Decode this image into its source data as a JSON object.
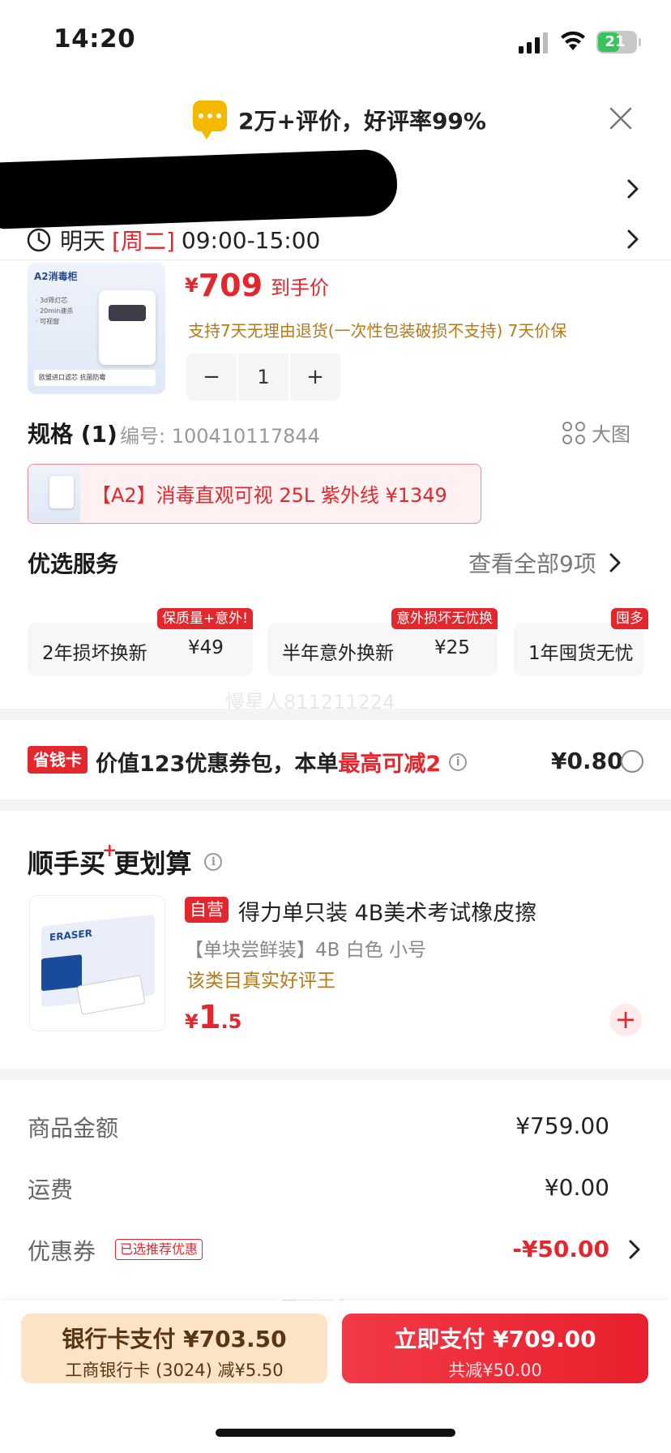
{
  "status_bar": {
    "time": "14:20",
    "battery": "21"
  },
  "banner": {
    "icon": "chat-bubble-icon",
    "text": "2万+评价，好评率99%"
  },
  "delivery": {
    "prefix": "明天",
    "weekday": "[周二]",
    "window": "09:00-15:00"
  },
  "product": {
    "image_tag": "A2消毒柜",
    "image_bullets": [
      "· 3d筛灯芯",
      "· 20min速杀",
      "· 可视窗"
    ],
    "image_footer": "欧盟进口滤芯 抗菌防霉",
    "price_symbol": "¥",
    "price": "709",
    "price_suffix": "到手价",
    "returns": "支持7天无理由退货(一次性包装破损不支持) 7天价保",
    "quantity": "1",
    "minus": "−",
    "plus": "+"
  },
  "spec": {
    "title": "规格 (1)",
    "code": "编号: 100410117844",
    "big_image": "大图",
    "selected": "【A2】消毒直观可视 25L 紫外线 ¥1349"
  },
  "services": {
    "title": "优选服务",
    "view_all": "查看全部9项",
    "items": [
      {
        "badge": "保质量+意外!",
        "label": "2年损坏换新",
        "price": "¥49"
      },
      {
        "badge": "意外损坏无忧换",
        "label": "半年意外换新",
        "price": "¥25"
      },
      {
        "badge": "囤多",
        "label": "1年囤货无忧",
        "price": ""
      }
    ],
    "watermark": "慢星人811211224"
  },
  "coupon_pack": {
    "badge": "省钱卡",
    "text_prefix": "价值123优惠券包，本单",
    "text_highlight": "最高可减2",
    "amount": "¥0.80"
  },
  "bundle": {
    "title_left": "顺手买",
    "title_plus": "+",
    "title_right": "更划算",
    "image_label": "ERASER",
    "self_badge": "自营",
    "name": "得力单只装 4B美术考试橡皮擦",
    "spec": "【单块尝鲜装】4B 白色 小号",
    "rank": "该类目真实好评王",
    "price_symbol": "¥",
    "price_int": "1",
    "price_dec": ".5",
    "add": "+"
  },
  "summary": {
    "goods_label": "商品金额",
    "goods_value": "¥759.00",
    "shipping_label": "运费",
    "shipping_value": "¥0.00",
    "coupon_label": "优惠券",
    "coupon_badge": "已选推荐优惠",
    "coupon_value": "-¥50.00",
    "faded_text": "展开更多"
  },
  "bottom": {
    "bank_line1": "银行卡支付 ¥703.50",
    "bank_line2": "工商银行卡 (3024) 减¥5.50",
    "pay_line1": "立即支付 ¥709.00",
    "pay_line2": "共减¥50.00"
  },
  "colors": {
    "accent_red": "#e4262d",
    "gold_text": "#b57a18",
    "bank_bg": "#fde3c5"
  }
}
